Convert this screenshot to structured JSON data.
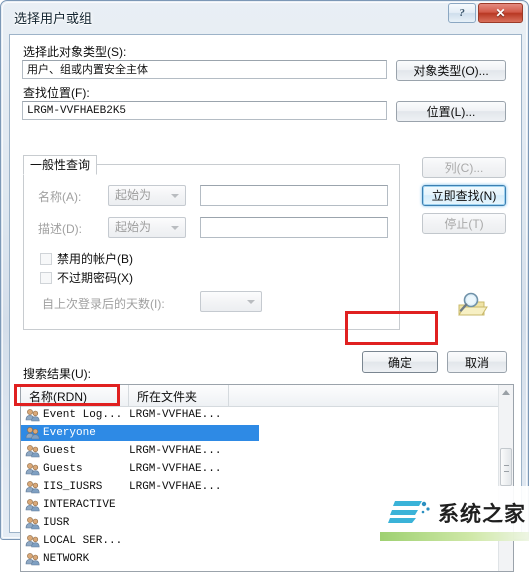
{
  "window": {
    "title": "选择用户或组",
    "help_button": "?",
    "close_button": "✕"
  },
  "object_type": {
    "label": "选择此对象类型(S):",
    "value": "用户、组或内置安全主体",
    "button": "对象类型(O)..."
  },
  "location": {
    "label": "查找位置(F):",
    "value": "LRGM-VVFHAEB2K5",
    "button": "位置(L)..."
  },
  "tab": {
    "label": "一般性查询"
  },
  "query": {
    "name_label": "名称(A):",
    "name_condition": "起始为",
    "name_value": "",
    "desc_label": "描述(D):",
    "desc_condition": "起始为",
    "desc_value": "",
    "disabled_accounts": "禁用的帐户(B)",
    "non_expiring_password": "不过期密码(X)",
    "days_since_logon_label": "自上次登录后的天数(I):",
    "days_since_logon_value": ""
  },
  "side_buttons": {
    "columns": "列(C)...",
    "find_now": "立即查找(N)",
    "stop": "停止(T)"
  },
  "dialog_buttons": {
    "ok": "确定",
    "cancel": "取消"
  },
  "results": {
    "label": "搜索结果(U):",
    "columns": [
      "名称(RDN)",
      "所在文件夹",
      ""
    ],
    "rows": [
      {
        "name": "Event Log...",
        "folder": "LRGM-VVFHAE...",
        "selected": false
      },
      {
        "name": "Everyone",
        "folder": "",
        "selected": true
      },
      {
        "name": "Guest",
        "folder": "LRGM-VVFHAE...",
        "selected": false
      },
      {
        "name": "Guests",
        "folder": "LRGM-VVFHAE...",
        "selected": false
      },
      {
        "name": "IIS_IUSRS",
        "folder": "LRGM-VVFHAE...",
        "selected": false
      },
      {
        "name": "INTERACTIVE",
        "folder": "",
        "selected": false
      },
      {
        "name": "IUSR",
        "folder": "",
        "selected": false
      },
      {
        "name": "LOCAL SER...",
        "folder": "",
        "selected": false
      },
      {
        "name": "NETWORK",
        "folder": "",
        "selected": false
      }
    ]
  },
  "watermark": {
    "text": "系统之家"
  },
  "colors": {
    "selection_blue": "#2e8ae5",
    "annotation_red": "#e02020",
    "close_red": "#b83823",
    "watermark_green": "#7ec142"
  }
}
